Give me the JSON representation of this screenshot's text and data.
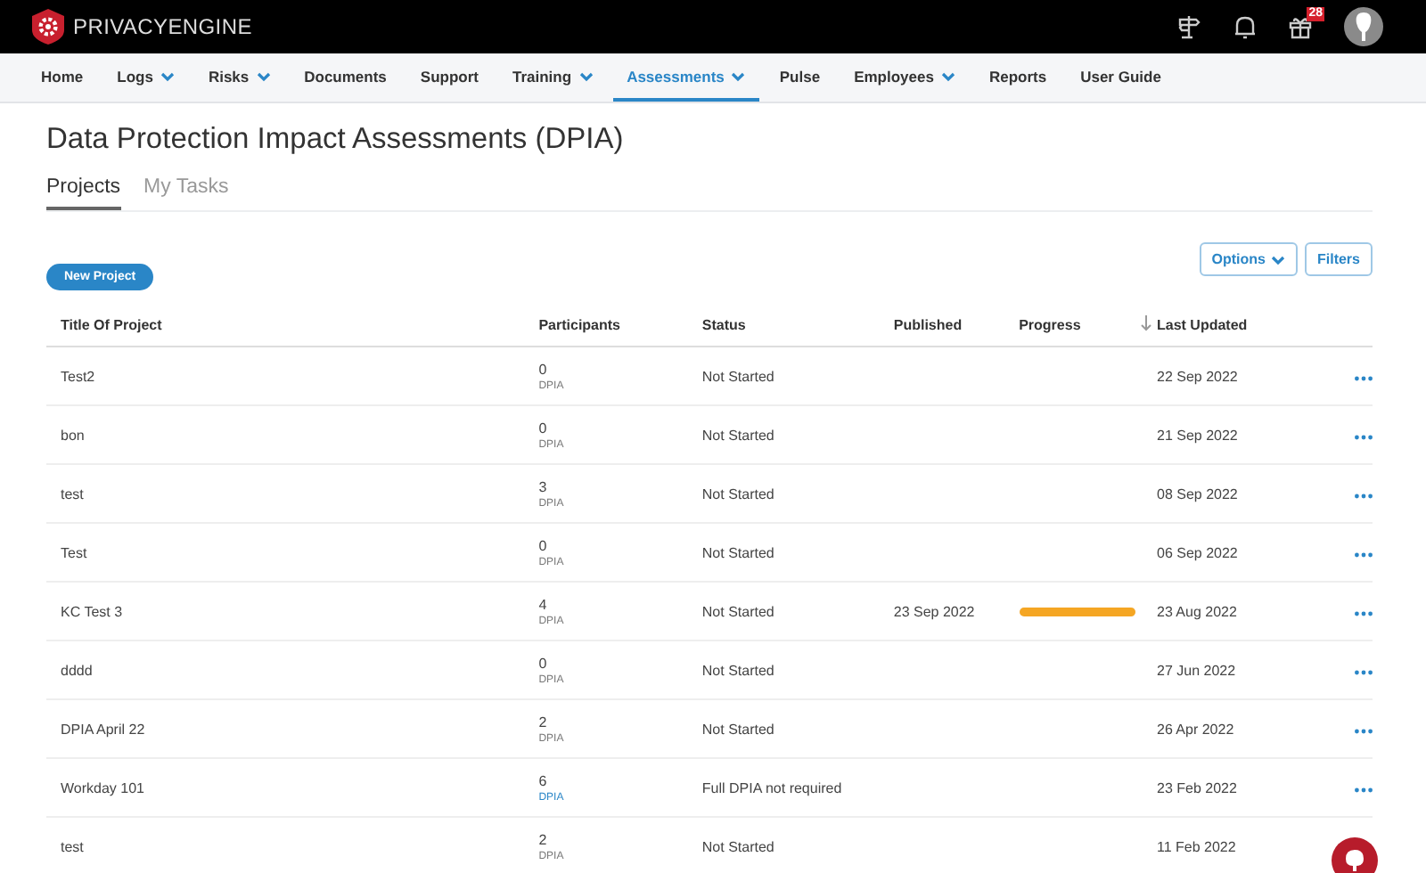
{
  "header": {
    "logo_text": "PRIVACYENGINE",
    "notification_badge": "28"
  },
  "nav": [
    {
      "label": "Home",
      "dropdown": false,
      "selected": false
    },
    {
      "label": "Logs",
      "dropdown": true,
      "selected": false
    },
    {
      "label": "Risks",
      "dropdown": true,
      "selected": false
    },
    {
      "label": "Documents",
      "dropdown": false,
      "selected": false
    },
    {
      "label": "Support",
      "dropdown": false,
      "selected": false
    },
    {
      "label": "Training",
      "dropdown": true,
      "selected": false
    },
    {
      "label": "Assessments",
      "dropdown": true,
      "selected": true
    },
    {
      "label": "Pulse",
      "dropdown": false,
      "selected": false
    },
    {
      "label": "Employees",
      "dropdown": true,
      "selected": false
    },
    {
      "label": "Reports",
      "dropdown": false,
      "selected": false
    },
    {
      "label": "User Guide",
      "dropdown": false,
      "selected": false
    }
  ],
  "page_title": "Data Protection Impact Assessments (DPIA)",
  "tabs": [
    {
      "label": "Projects",
      "selected": true
    },
    {
      "label": "My Tasks",
      "selected": false
    }
  ],
  "new_project_button": "New Project",
  "toolbar_buttons": [
    {
      "label": "Options",
      "dropdown": true
    },
    {
      "label": "Filters",
      "dropdown": false
    }
  ],
  "table": {
    "columns": [
      {
        "label": "Title Of Project",
        "sorted": false
      },
      {
        "label": "Participants",
        "sorted": false
      },
      {
        "label": "Status",
        "sorted": false
      },
      {
        "label": "Published",
        "sorted": false
      },
      {
        "label": "Progress",
        "sorted": false
      },
      {
        "label": "Last Updated",
        "sorted": true
      }
    ],
    "rows": [
      {
        "title": "Test2",
        "participants": "0",
        "participant_type": "DPIA",
        "type_link": false,
        "status": "Not Started",
        "published": "",
        "last_updated": "22 Sep 2022"
      },
      {
        "title": "bon",
        "participants": "0",
        "participant_type": "DPIA",
        "type_link": false,
        "status": "Not Started",
        "published": "",
        "last_updated": "21 Sep 2022"
      },
      {
        "title": "test",
        "participants": "3",
        "participant_type": "DPIA",
        "type_link": false,
        "status": "Not Started",
        "published": "",
        "last_updated": "08 Sep 2022"
      },
      {
        "title": "Test",
        "participants": "0",
        "participant_type": "DPIA",
        "type_link": false,
        "status": "Not Started",
        "published": "",
        "last_updated": "06 Sep 2022"
      },
      {
        "title": "KC Test 3",
        "participants": "4",
        "participant_type": "DPIA",
        "type_link": false,
        "status": "Not Started",
        "published": "23 Sep 2022",
        "level": 1,
        "last_updated": "23 Aug 2022"
      },
      {
        "title": "dddd",
        "participants": "0",
        "participant_type": "DPIA",
        "type_link": false,
        "status": "Not Started",
        "published": "",
        "last_updated": "27 Jun 2022"
      },
      {
        "title": "DPIA April 22",
        "participants": "2",
        "participant_type": "DPIA",
        "type_link": false,
        "status": "Not Started",
        "published": "",
        "last_updated": "26 Apr 2022"
      },
      {
        "title": "Workday 101",
        "participants": "6",
        "participant_type": "DPIA",
        "type_link": true,
        "status": "Full DPIA not required",
        "published": "",
        "last_updated": "23 Feb 2022"
      },
      {
        "title": "test",
        "participants": "2",
        "participant_type": "DPIA",
        "type_link": false,
        "status": "Not Started",
        "published": "",
        "last_updated": "11 Feb 2022"
      }
    ]
  }
}
